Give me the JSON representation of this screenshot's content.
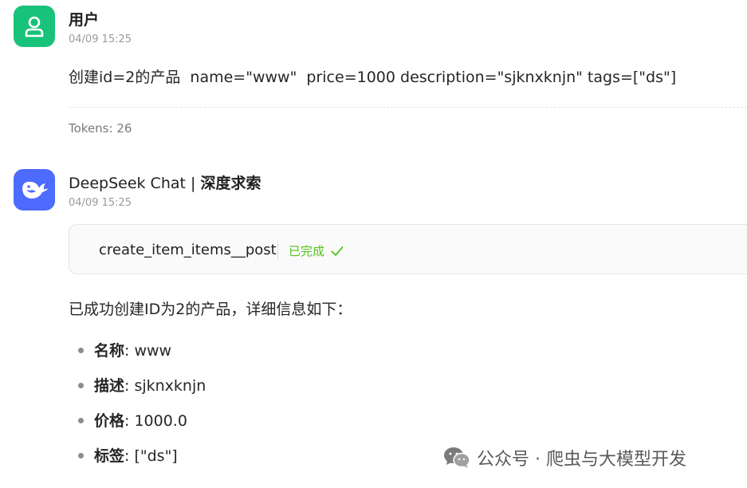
{
  "user_message": {
    "sender": "用户",
    "timestamp": "04/09 15:25",
    "text": "创建id=2的产品  name=\"www\"  price=1000 description=\"sjknxknjn\" tags=[\"ds\"]",
    "tokens": "Tokens: 26"
  },
  "bot_message": {
    "sender_name": "DeepSeek Chat | ",
    "sender_suffix": "深度求索",
    "timestamp": "04/09 15:25",
    "tool_call": {
      "name": "create_item_items__post",
      "status": "已完成",
      "status_color": "#52c41a"
    },
    "intro": "已成功创建ID为2的产品，详细信息如下：",
    "details": [
      {
        "key": "名称",
        "value": ": www"
      },
      {
        "key": "描述",
        "value": ": sjknxknjn"
      },
      {
        "key": "价格",
        "value": ": 1000.0"
      },
      {
        "key": "标签",
        "value": ": [\"ds\"]"
      }
    ]
  },
  "watermark": {
    "text": "公众号 · 爬虫与大模型开发",
    "icon": "wechat-icon"
  },
  "colors": {
    "user_avatar": "#19c27a",
    "bot_avatar": "#4d6bfe"
  }
}
